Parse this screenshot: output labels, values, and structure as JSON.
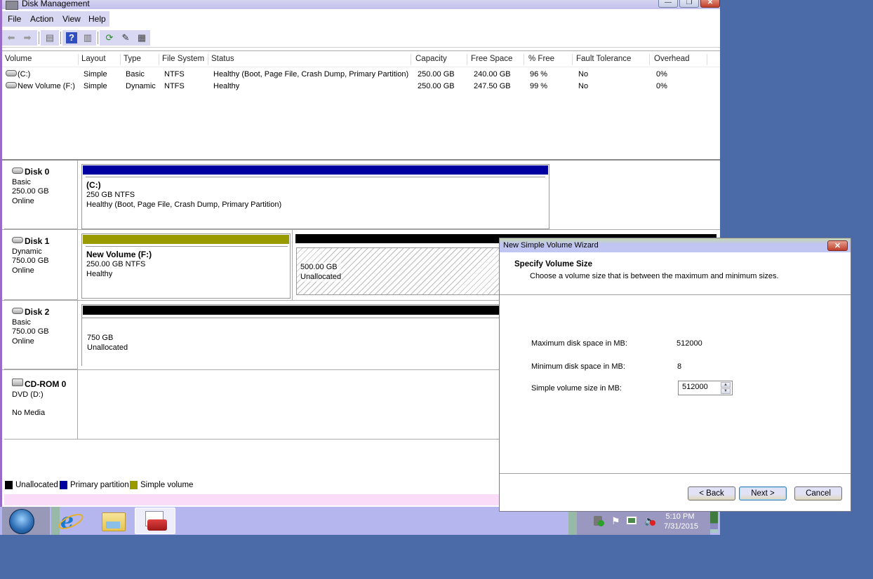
{
  "window": {
    "title": "Disk Management",
    "controls": {
      "minimize": "—",
      "restore": "❐",
      "close": "✕"
    }
  },
  "menu": {
    "items": [
      "File",
      "Action",
      "View",
      "Help"
    ]
  },
  "toolbar": {
    "icons": [
      "back-arrow-icon",
      "forward-arrow-icon",
      "show-hide-console-tree-icon",
      "help-icon",
      "show-hide-action-pane-icon",
      "refresh-icon",
      "properties-icon",
      "disk-settings-icon"
    ],
    "glyphs": {
      "back": "⬅",
      "forward": "➡",
      "console": "▤",
      "help": "?",
      "action": "▥",
      "refresh": "⟳",
      "properties": "✎",
      "settings": "▦"
    }
  },
  "volume_list": {
    "columns": [
      "Volume",
      "Layout",
      "Type",
      "File System",
      "Status",
      "Capacity",
      "Free Space",
      "% Free",
      "Fault Tolerance",
      "Overhead"
    ],
    "rows": [
      {
        "volume": "(C:)",
        "layout": "Simple",
        "type": "Basic",
        "fs": "NTFS",
        "status": "Healthy (Boot, Page File, Crash Dump, Primary Partition)",
        "capacity": "250.00 GB",
        "free": "240.00 GB",
        "pct_free": "96 %",
        "fault": "No",
        "overhead": "0%"
      },
      {
        "volume": "New Volume (F:)",
        "layout": "Simple",
        "type": "Dynamic",
        "fs": "NTFS",
        "status": "Healthy",
        "capacity": "250.00 GB",
        "free": "247.50 GB",
        "pct_free": "99 %",
        "fault": "No",
        "overhead": "0%"
      }
    ]
  },
  "disks": [
    {
      "name": "Disk 0",
      "kind": "Basic",
      "size": "250.00 GB",
      "state": "Online",
      "partitions": [
        {
          "title": "(C:)",
          "line1": "250 GB NTFS",
          "line2": "Healthy (Boot, Page File, Crash Dump, Primary Partition)",
          "color": "#0000a0"
        }
      ]
    },
    {
      "name": "Disk 1",
      "kind": "Dynamic",
      "size": "750.00 GB",
      "state": "Online",
      "partitions": [
        {
          "title": "New Volume (F:)",
          "line1": "250.00 GB NTFS",
          "line2": "Healthy",
          "color": "#999900"
        },
        {
          "title": "",
          "line1": "500.00 GB",
          "line2": "Unallocated",
          "color": "#000000"
        }
      ]
    },
    {
      "name": "Disk 2",
      "kind": "Basic",
      "size": "750.00 GB",
      "state": "Online",
      "partitions": [
        {
          "title": "",
          "line1": "750 GB",
          "line2": "Unallocated",
          "color": "#000000"
        }
      ]
    },
    {
      "name": "CD-ROM 0",
      "kind": "DVD (D:)",
      "size": "",
      "state": "No Media",
      "partitions": []
    }
  ],
  "legend": [
    {
      "label": "Unallocated",
      "color": "#000000"
    },
    {
      "label": "Primary partition",
      "color": "#0000a0"
    },
    {
      "label": "Simple volume",
      "color": "#999900"
    }
  ],
  "wizard": {
    "title": "New Simple Volume Wizard",
    "heading": "Specify Volume Size",
    "subheading": "Choose a volume size that is between the maximum and minimum sizes.",
    "max_label": "Maximum disk space in MB:",
    "max_value": "512000",
    "min_label": "Minimum disk space in MB:",
    "min_value": "8",
    "size_label": "Simple volume size in MB:",
    "size_value": "512000",
    "buttons": {
      "back": "< Back",
      "next": "Next >",
      "cancel": "Cancel"
    },
    "close_glyph": "✕"
  },
  "taskbar": {
    "apps": [
      "internet-explorer",
      "windows-explorer",
      "computer-management"
    ],
    "clock": {
      "time": "5:10 PM",
      "date": "7/31/2015"
    }
  }
}
